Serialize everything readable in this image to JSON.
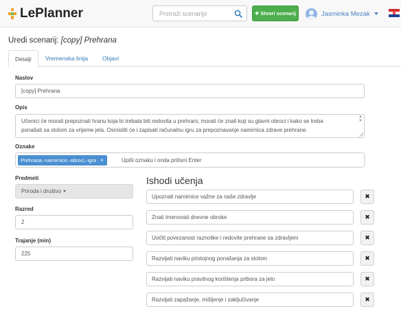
{
  "app": {
    "brand": "LePlanner"
  },
  "navbar": {
    "search_placeholder": "Pretraži scenarije",
    "create_label": "Stvori scenarij",
    "user_name": "Jasminka Mezak"
  },
  "page": {
    "title_prefix": "Uredi scenarij:",
    "title_name": "[copy] Prehrana"
  },
  "tabs": [
    {
      "label": "Detalji",
      "active": true
    },
    {
      "label": "Vremenska linija",
      "active": false
    },
    {
      "label": "Objavi",
      "active": false
    }
  ],
  "form": {
    "title_label": "Naslov",
    "title_value": "[copy] Prehrana",
    "description_label": "Opis",
    "description_line1": "Učenici će morati prepoznati hranu koja bi trebala biti redovita u prehrani, morati će znati koji su glavni obroci i kako se treba",
    "description_line2": "ponašati sa stolom za vrijeme jela. Osmisliti će i zapisati računalnu igru za prepoznavanje namirnica zdrave prehrane.",
    "tags_label": "Oznake",
    "tag_value": "Prehrana,-namirnice,-obroci,-igra",
    "tag_placeholder": "Upiši oznaku i onda pritisni Enter",
    "subjects_label": "Predmeti",
    "subject_selected": "Priroda i društvo",
    "grade_label": "Razred",
    "grade_value": "2",
    "duration_label": "Trajanje (min)",
    "duration_value": "225"
  },
  "outcomes": {
    "title": "Ishodi učenja",
    "items": [
      "Upoznati namirnice važne za naše zdravlje",
      "Znati imenovati dnevne obroke",
      "Uočiti povezanost raznolike i redovite prehrane sa zdravljem",
      "Razvijati naviku pristojnog ponašanja za stolom",
      "Razvijati naviku pravilnog korištenja pribora za jelo",
      "Razvijati zapažanje, mišljenje i zaključivanje"
    ],
    "delete_symbol": "✖"
  },
  "colors": {
    "brand_orange": "#f0a02d",
    "create_green": "#4cae4c",
    "link_blue": "#337ab7",
    "tag_blue": "#4a8fd1"
  }
}
